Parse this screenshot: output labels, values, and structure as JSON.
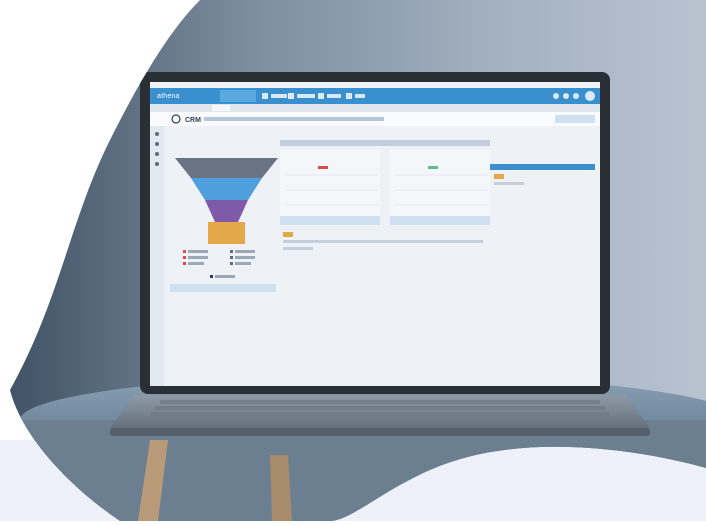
{
  "app": {
    "brand": "athena",
    "module": "CRM"
  }
}
